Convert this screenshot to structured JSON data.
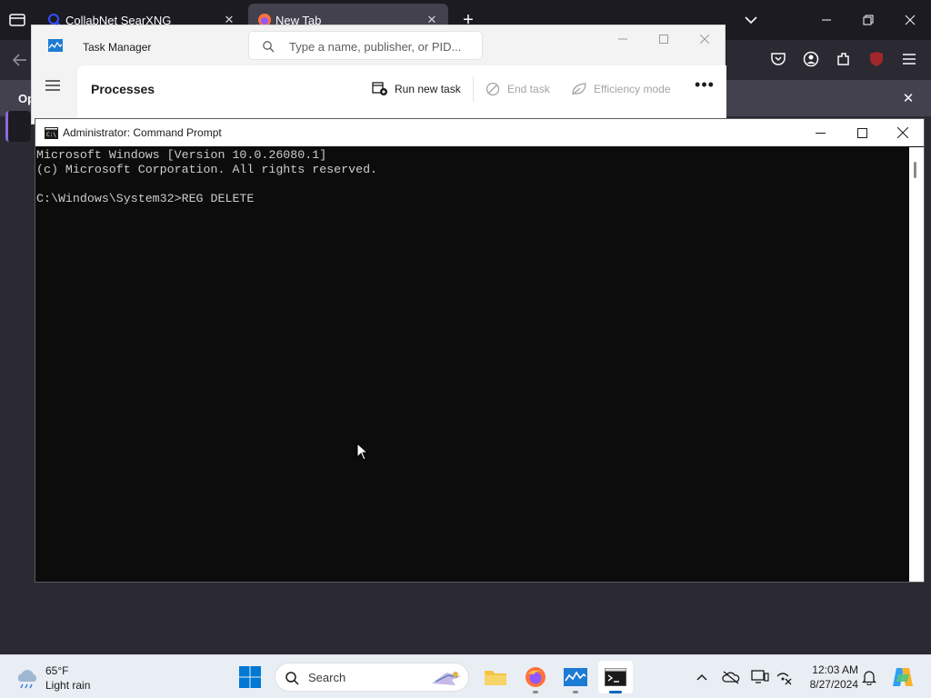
{
  "browser": {
    "tabs": [
      {
        "label": "CollabNet SearXNG",
        "active": false
      },
      {
        "label": "New Tab",
        "active": true
      }
    ],
    "notification_text": "Op"
  },
  "task_manager": {
    "title": "Task Manager",
    "search_placeholder": "Type a name, publisher, or PID...",
    "page_title": "Processes",
    "commands": {
      "run_new_task": "Run new task",
      "end_task": "End task",
      "efficiency_mode": "Efficiency mode"
    }
  },
  "cmd": {
    "title": "Administrator: Command Prompt",
    "lines": [
      "Microsoft Windows [Version 10.0.26080.1]",
      "(c) Microsoft Corporation. All rights reserved.",
      "",
      "C:\\Windows\\System32>REG DELETE"
    ]
  },
  "taskbar": {
    "weather": {
      "temp": "65°F",
      "desc": "Light rain"
    },
    "search_label": "Search",
    "clock": {
      "time": "12:03 AM",
      "date": "8/27/2024"
    },
    "apps": [
      "file-explorer",
      "firefox",
      "task-manager",
      "command-prompt"
    ]
  },
  "colors": {
    "browser_bg": "#2b2a33",
    "terminal_bg": "#0c0c0c",
    "terminal_fg": "#cccccc",
    "accent": "#0067c0"
  }
}
